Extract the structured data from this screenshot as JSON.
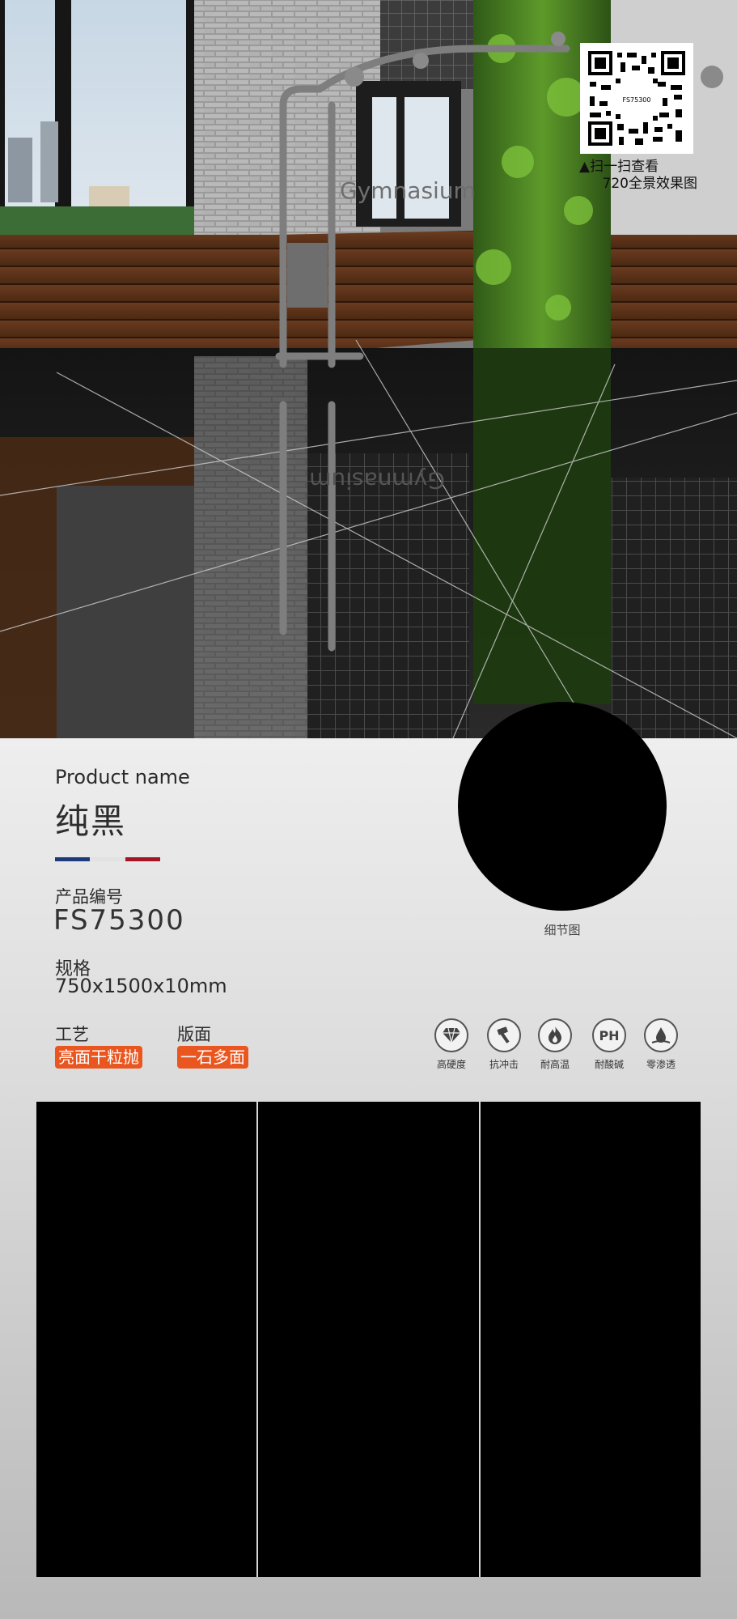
{
  "hero": {
    "wall_sign_text": "Gymnasium",
    "qr": {
      "inner_code": "FS75300",
      "caption_line1": "▲扫一扫查看",
      "caption_line2": "720全景效果图"
    }
  },
  "product": {
    "name_label_en": "Product name",
    "name_cn": "纯黑",
    "code_label": "产品编号",
    "code": "FS75300",
    "spec_label": "规格",
    "spec": "750x1500x10mm",
    "craft_label": "工艺",
    "craft_value": "亮面干粒抛",
    "surface_label": "版面",
    "surface_value": "一石多面",
    "flag_colors": [
      "#1f3a7a",
      "#e6e6e6",
      "#a3162a"
    ],
    "accent_color": "#e9561f"
  },
  "detail": {
    "label": "细节图",
    "swatch_color": "#000000"
  },
  "features": [
    {
      "icon": "diamond-icon",
      "label": "高硬度"
    },
    {
      "icon": "hammer-icon",
      "label": "抗冲击"
    },
    {
      "icon": "flame-icon",
      "label": "耐高温"
    },
    {
      "icon": "ph-icon",
      "label": "耐酸碱",
      "symbol": "PH"
    },
    {
      "icon": "water-drop-icon",
      "label": "零渗透"
    }
  ],
  "tiles": {
    "count": 3,
    "color": "#000000"
  }
}
